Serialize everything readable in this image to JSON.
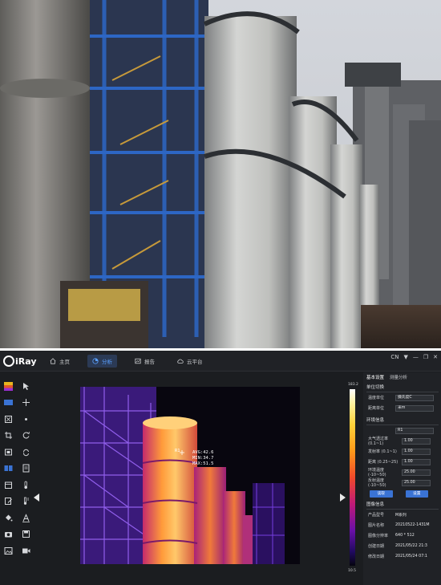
{
  "app": {
    "brand": "iRay",
    "nav": [
      {
        "label": "主页",
        "icon": "home-icon"
      },
      {
        "label": "分析",
        "icon": "chart-icon"
      },
      {
        "label": "报告",
        "icon": "report-icon"
      },
      {
        "label": "云平台",
        "icon": "cloud-icon"
      }
    ],
    "active_tab": 1,
    "language": "CN",
    "window_controls": {
      "chevron": "▼",
      "minimize": "—",
      "restore": "❐",
      "close": "✕"
    }
  },
  "thermal": {
    "marker": "R1",
    "avg": "AVG:42.6",
    "min": "MIN:34.7",
    "max": "MAX:51.5",
    "scale_max": "183.2",
    "scale_min": "10.5"
  },
  "panel": {
    "tabs": [
      "基本设置",
      "测量分析"
    ],
    "unit_section": "单位切换",
    "temp_unit_label": "温度单位",
    "temp_unit_value": "摄氏度C",
    "dist_unit_label": "距离单位",
    "dist_unit_value": "米m",
    "env_section": "环境信息",
    "env_value": "R1",
    "atm_trans_label": "大气透过率",
    "atm_trans_range": "(0.1~1)",
    "atm_trans_value": "1.00",
    "emissivity_label": "发射率",
    "emissivity_range": "(0.1~1)",
    "emissivity_value": "1.00",
    "distance_label": "距离",
    "distance_range": "(0.25~25)",
    "distance_value": "1.00",
    "amb_temp_label": "环境温度",
    "amb_temp_range": "(-10~50)",
    "amb_temp_value": "25.00",
    "refl_temp_label": "反射温度",
    "refl_temp_range": "(-10~50)",
    "refl_temp_value": "25.00",
    "read_button": "读取",
    "set_button": "设置",
    "image_section": "图像信息",
    "model_label": "产品型号",
    "model_value": "M系列",
    "name_label": "图片名称",
    "name_value": "20210522-1431M",
    "resolution_label": "图像分辨率",
    "resolution_value": "640 * 512",
    "created_label": "创建日期",
    "created_value": "2021/05/22 21:3",
    "modified_label": "修改日期",
    "modified_value": "2021/05/24 07:1"
  }
}
